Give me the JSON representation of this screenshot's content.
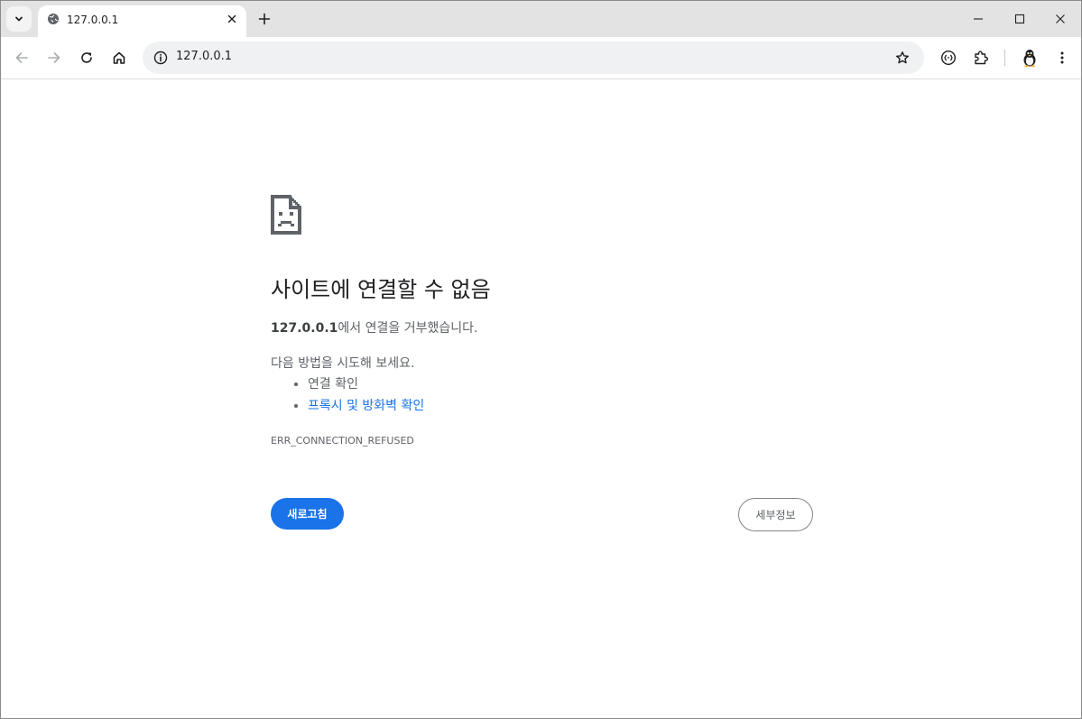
{
  "tab": {
    "title": "127.0.0.1",
    "favicon": "globe-icon"
  },
  "omnibox": {
    "url": "127.0.0.1",
    "info_icon": "info-icon",
    "star_icon": "star-icon"
  },
  "toolbar": {
    "back_icon": "arrow-left-icon",
    "forward_icon": "arrow-right-icon",
    "reload_icon": "reload-icon",
    "home_icon": "home-icon",
    "extension_icons": [
      "reading-mode-icon",
      "puzzle-icon",
      "avatar-penguin-icon",
      "kebab-menu-icon"
    ]
  },
  "error_page": {
    "heading": "사이트에 연결할 수 없음",
    "host": "127.0.0.1",
    "description_suffix": "에서 연결을 거부했습니다.",
    "try_label": "다음 방법을 시도해 보세요.",
    "suggestions": [
      {
        "text": "연결 확인",
        "link": false
      },
      {
        "text": "프록시 및 방화벽 확인",
        "link": true
      }
    ],
    "error_code": "ERR_CONNECTION_REFUSED",
    "reload_button": "새로고침",
    "details_button": "세부정보"
  },
  "colors": {
    "accent": "#1a73e8",
    "text_primary": "#202124",
    "text_secondary": "#5f6368",
    "tabstrip_bg": "#e3e3e3",
    "omnibox_bg": "#eff1f3"
  }
}
